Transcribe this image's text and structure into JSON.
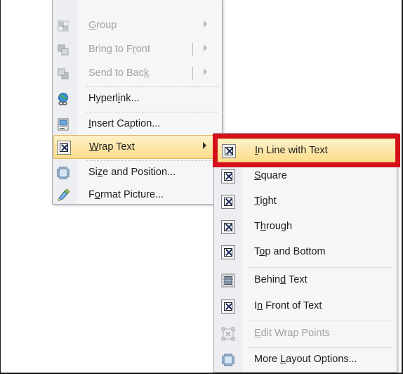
{
  "main_menu": {
    "items": [
      {
        "label_pre": "",
        "label_key": "G",
        "label_post": "roup",
        "icon": "group-icon",
        "disabled": true,
        "submenu": true
      },
      {
        "label_pre": "Bring to F",
        "label_key": "r",
        "label_post": "ont",
        "icon": "bring-to-front-icon",
        "disabled": true,
        "submenu": true
      },
      {
        "label_pre": "Send to Bac",
        "label_key": "k",
        "label_post": "",
        "icon": "send-to-back-icon",
        "disabled": true,
        "submenu": true
      },
      {
        "label_pre": "Hyperl",
        "label_key": "i",
        "label_post": "nk...",
        "icon": "hyperlink-icon",
        "disabled": false,
        "submenu": false
      },
      {
        "label_pre": "",
        "label_key": "I",
        "label_post": "nsert Caption...",
        "icon": "insert-caption-icon",
        "disabled": false,
        "submenu": false
      },
      {
        "label_pre": "",
        "label_key": "W",
        "label_post": "rap Text",
        "icon": "wrap-text-icon",
        "disabled": false,
        "submenu": true
      },
      {
        "label_pre": "Si",
        "label_key": "z",
        "label_post": "e and Position...",
        "icon": "size-position-icon",
        "disabled": false,
        "submenu": false
      },
      {
        "label_pre": "F",
        "label_key": "o",
        "label_post": "rmat Picture...",
        "icon": "format-picture-icon",
        "disabled": false,
        "submenu": false
      }
    ]
  },
  "wrap_submenu": {
    "items": [
      {
        "label_pre": "",
        "label_key": "I",
        "label_post": "n Line with Text",
        "icon": "in-line-with-text-icon"
      },
      {
        "label_pre": "",
        "label_key": "S",
        "label_post": "quare",
        "icon": "square-wrap-icon"
      },
      {
        "label_pre": "",
        "label_key": "T",
        "label_post": "ight",
        "icon": "tight-wrap-icon"
      },
      {
        "label_pre": "T",
        "label_key": "h",
        "label_post": "rough",
        "icon": "through-wrap-icon"
      },
      {
        "label_pre": "T",
        "label_key": "o",
        "label_post": "p and Bottom",
        "icon": "top-and-bottom-icon"
      },
      {
        "label_pre": "Behin",
        "label_key": "d",
        "label_post": " Text",
        "icon": "behind-text-icon"
      },
      {
        "label_pre": "I",
        "label_key": "n",
        "label_post": " Front of Text",
        "icon": "in-front-of-text-icon"
      },
      {
        "label_pre": "",
        "label_key": "E",
        "label_post": "dit Wrap Points",
        "icon": "edit-wrap-points-icon"
      },
      {
        "label_pre": "More ",
        "label_key": "L",
        "label_post": "ayout Options...",
        "icon": "more-layout-options-icon"
      }
    ]
  },
  "colors": {
    "highlight_box": "#d4111b",
    "hover_gradient_top": "#fdf1c9",
    "hover_gradient_bottom": "#fbdd8a",
    "menu_background": "#f5f6f7",
    "disabled_text": "#a2a2a2"
  }
}
